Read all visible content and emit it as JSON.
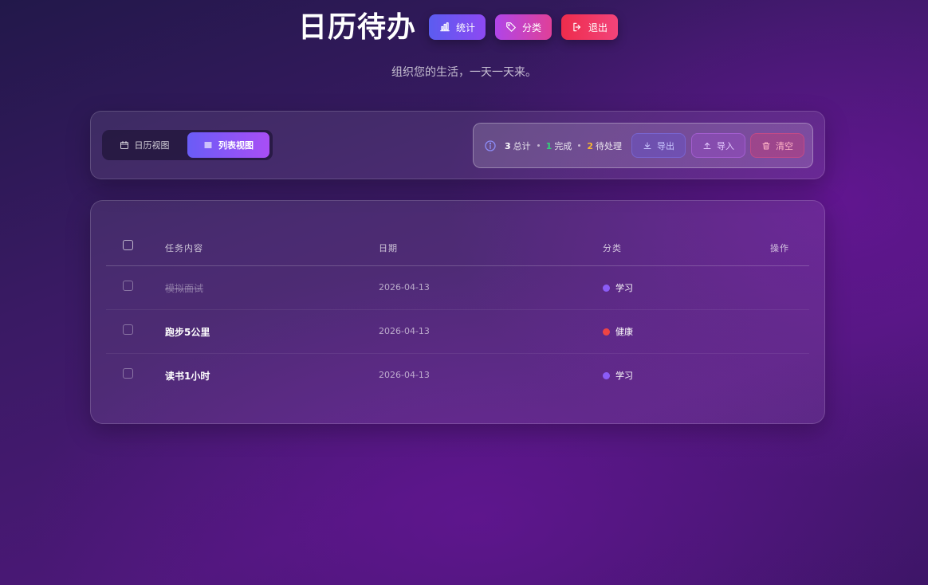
{
  "header": {
    "title": "日历待办",
    "buttons": {
      "stats": "统计",
      "categories": "分类",
      "logout": "退出"
    },
    "subtitle": "组织您的生活，一天一天来。"
  },
  "toolbar": {
    "views": {
      "calendar": "日历视图",
      "list": "列表视图",
      "active": "list"
    },
    "stats": {
      "total_count": "3",
      "total_label": "总计",
      "done_count": "1",
      "done_label": "完成",
      "pending_count": "2",
      "pending_label": "待处理"
    },
    "actions": {
      "export": "导出",
      "import": "导入",
      "clear": "清空"
    }
  },
  "table": {
    "columns": {
      "task": "任务内容",
      "date": "日期",
      "category": "分类",
      "actions": "操作"
    },
    "rows": [
      {
        "task": "模拟面试",
        "date": "2026-04-13",
        "category": "学习",
        "category_color": "#8b5cf6",
        "done": true
      },
      {
        "task": "跑步5公里",
        "date": "2026-04-13",
        "category": "健康",
        "category_color": "#ef4444",
        "done": false
      },
      {
        "task": "读书1小时",
        "date": "2026-04-13",
        "category": "学习",
        "category_color": "#8b5cf6",
        "done": false
      }
    ]
  },
  "colors": {
    "accent_primary": "#6a5cf6",
    "accent_secondary": "#a94ef5",
    "done_green": "#34d27a",
    "pending_amber": "#f7b731",
    "danger_red": "#ee2c4c"
  },
  "icons": {
    "stats": "bar-chart-icon",
    "categories": "tag-icon",
    "logout": "logout-icon",
    "calendar_view": "calendar-icon",
    "list_view": "list-icon",
    "info": "info-icon",
    "export": "download-icon",
    "import": "upload-icon",
    "clear": "trash-icon"
  }
}
